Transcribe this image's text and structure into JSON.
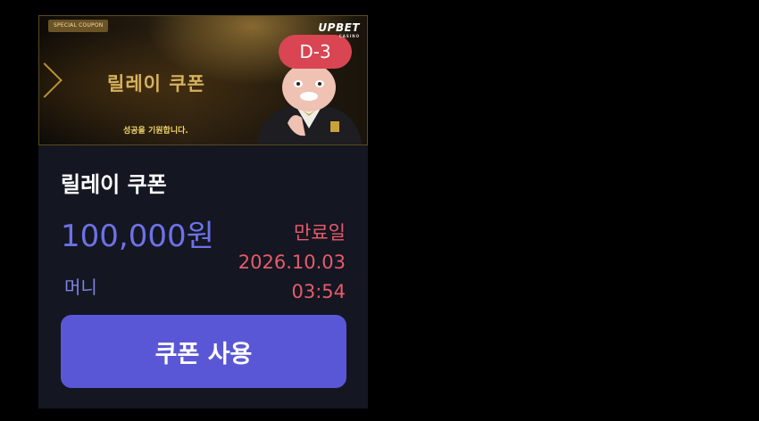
{
  "banner": {
    "tag": "SPECIAL COUPON",
    "title": "릴레이 쿠폰",
    "subtitle": "성공을 기원합니다.",
    "logo": "UPBET",
    "logo_sub": "CASINO",
    "dday": "D-3"
  },
  "coupon": {
    "title": "릴레이 쿠폰",
    "amount": "100,000원",
    "type": "머니",
    "expiry_label": "만료일",
    "expiry_date": "2026.10.03",
    "expiry_time": "03:54"
  },
  "button": {
    "label": "쿠폰 사용"
  },
  "colors": {
    "background": "#000000",
    "card": "#141622",
    "accent": "#5a57d6",
    "amount": "#6d72e6",
    "expiry": "#e45c6a",
    "dday": "#d94552"
  }
}
